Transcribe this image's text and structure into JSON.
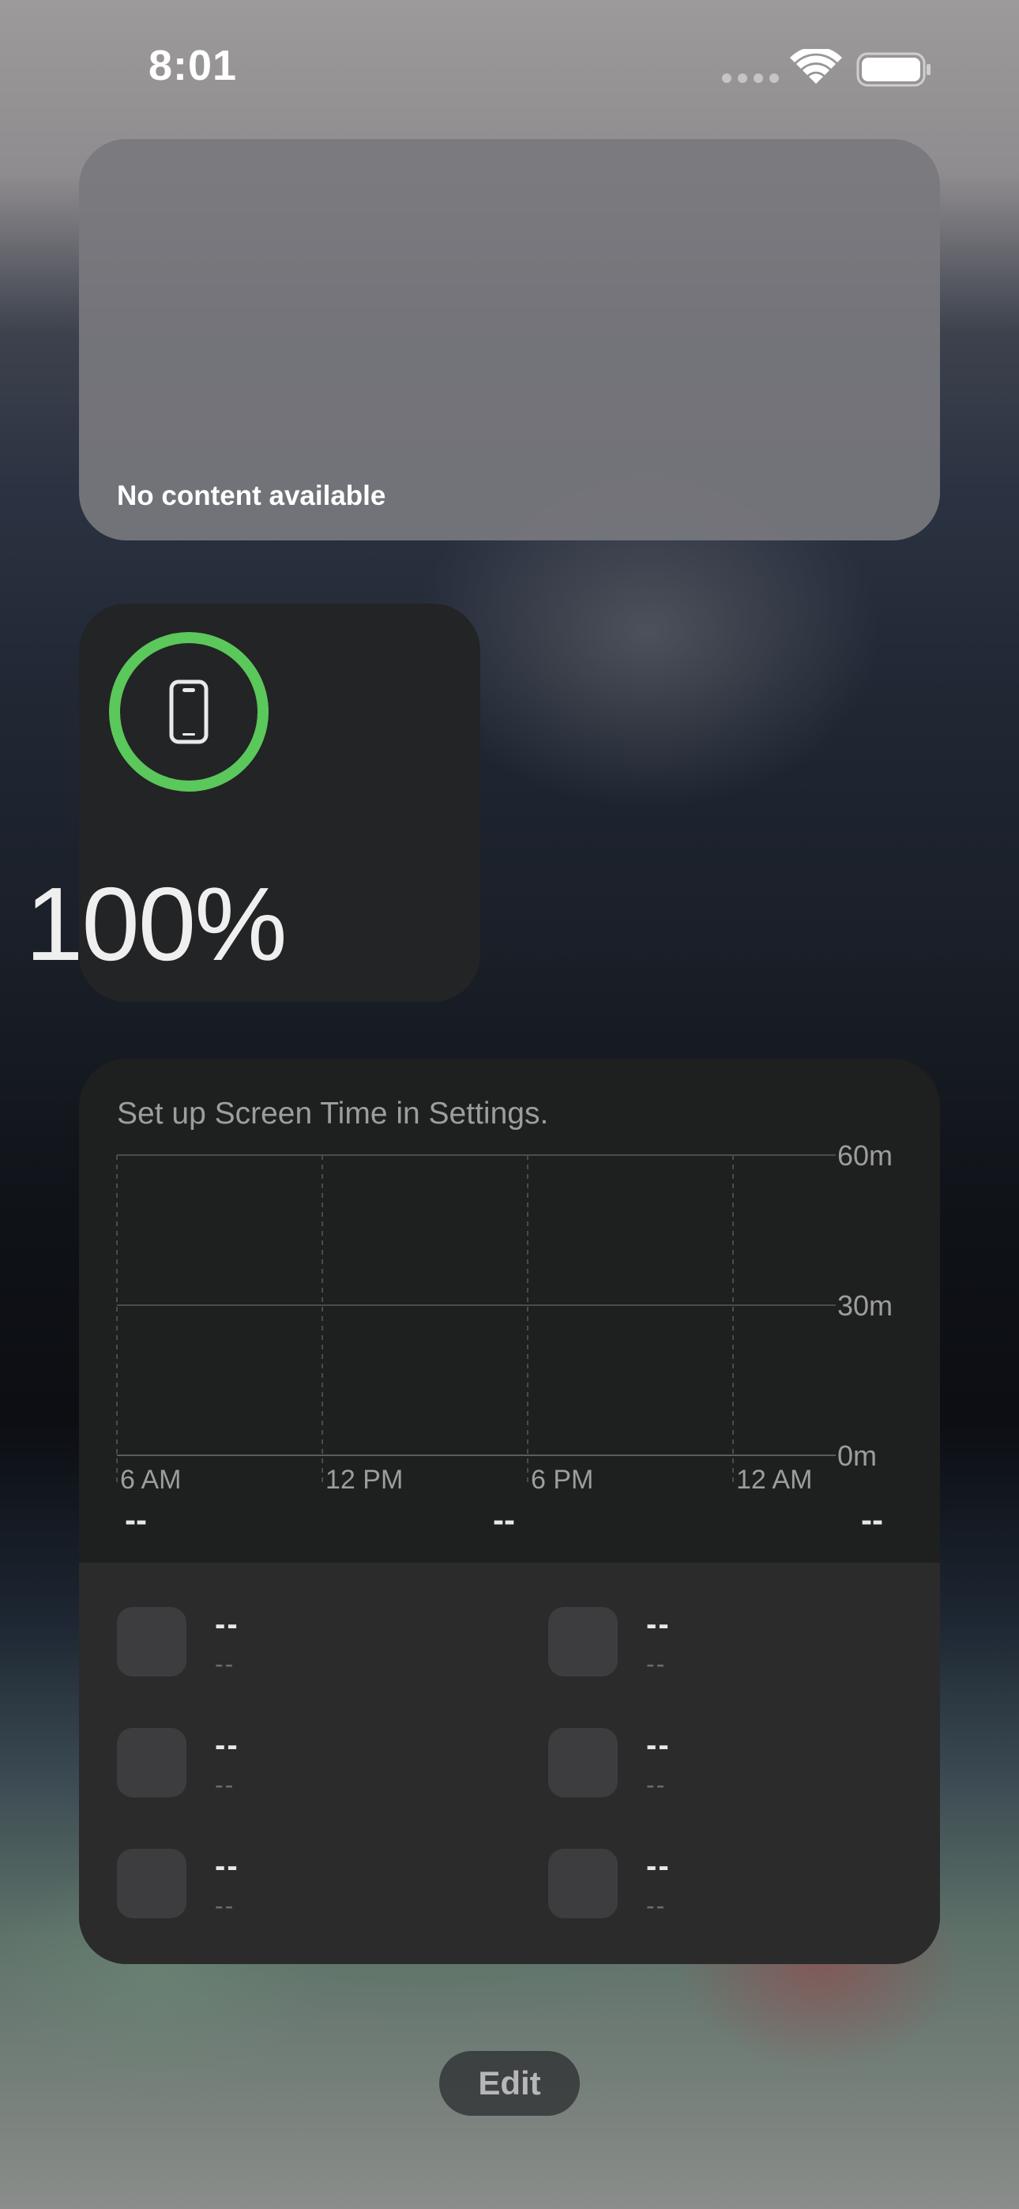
{
  "status_bar": {
    "time": "8:01",
    "icons": [
      "signal-dots-icon",
      "wifi-icon",
      "battery-icon"
    ]
  },
  "empty_widget": {
    "message": "No content available"
  },
  "battery_widget": {
    "device_icon": "iphone-icon",
    "percent": "100%",
    "level": 1.0,
    "ring_color": "#5ac85a"
  },
  "screen_time_widget": {
    "message": "Set up Screen Time in Settings.",
    "chart_data": {
      "type": "bar",
      "x_tick_labels": [
        "6 AM",
        "12 PM",
        "6 PM",
        "12 AM"
      ],
      "y_tick_labels": [
        "60m",
        "30m",
        "0m"
      ],
      "ylim": [
        0,
        60
      ],
      "values": [],
      "grid": true
    },
    "totals": [
      "--",
      "--",
      "--"
    ],
    "apps": [
      {
        "name": "--",
        "time": "--"
      },
      {
        "name": "--",
        "time": "--"
      },
      {
        "name": "--",
        "time": "--"
      },
      {
        "name": "--",
        "time": "--"
      },
      {
        "name": "--",
        "time": "--"
      },
      {
        "name": "--",
        "time": "--"
      }
    ]
  },
  "edit_button": {
    "label": "Edit"
  }
}
